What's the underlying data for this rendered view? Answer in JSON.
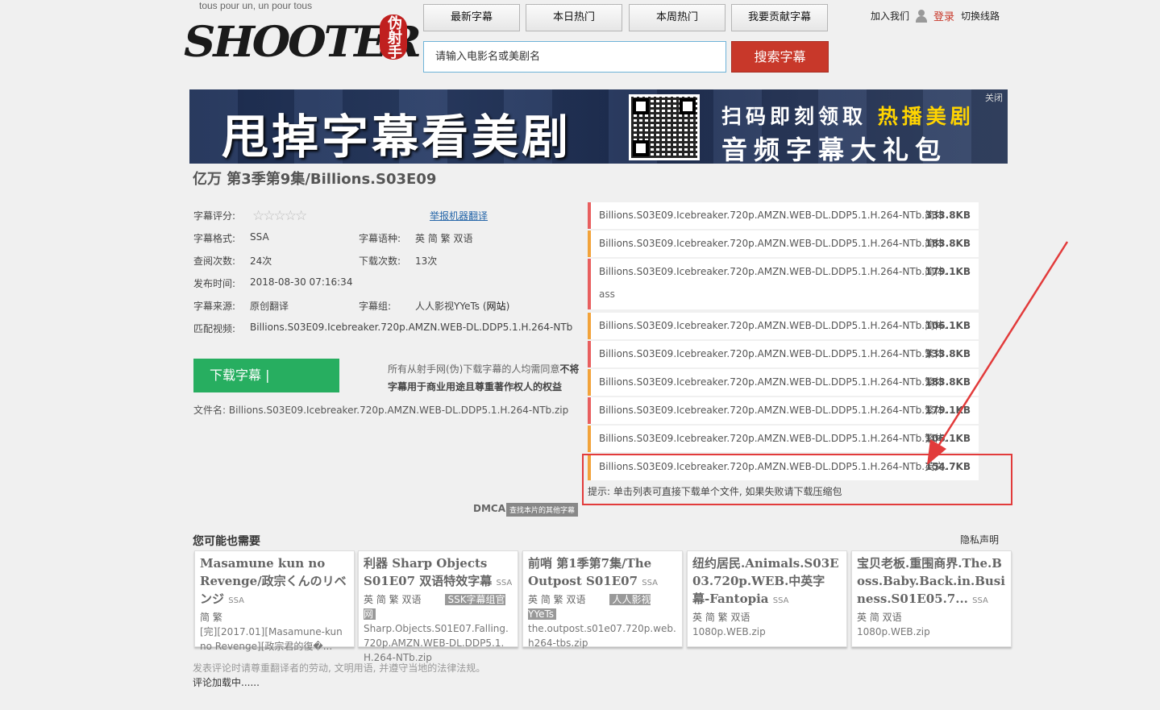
{
  "header": {
    "tagline": "tous pour un, un pour tous",
    "logo_text": "SHOOTER",
    "logo_seal": "伪射手",
    "nav": [
      "最新字幕",
      "本日热门",
      "本周热门",
      "我要贡献字幕"
    ],
    "search_placeholder": "请输入电影名或美剧名",
    "search_button": "搜索字幕",
    "join": "加入我们",
    "login": "登录",
    "switch_line": "切换线路"
  },
  "banner": {
    "title": "甩掉字幕看美剧",
    "line1_a": "扫码即刻领取",
    "line1_b": "热播美剧",
    "line2": "音频字幕大礼包",
    "close": "关闭"
  },
  "page_title": "亿万 第3季第9集/Billions.S03E09",
  "info": {
    "rating_label": "字幕评分:",
    "rating_stars": "☆☆☆☆☆",
    "report": "举报机器翻译",
    "format_label": "字幕格式:",
    "format": "SSA",
    "lang_label": "字幕语种:",
    "lang": "英 简 繁 双语",
    "views_label": "查阅次数:",
    "views": "24次",
    "downloads_label": "下载次数:",
    "downloads": "13次",
    "date_label": "发布时间:",
    "date": "2018-08-30 07:16:34",
    "source_label": "字幕来源:",
    "source": "原创翻译",
    "group_label": "字幕组:",
    "group": "人人影视YYeTs (",
    "group_site": "网站",
    "group_close": ")",
    "match_label": "匹配视频:",
    "match": "Billions.S03E09.Icebreaker.720p.AMZN.WEB-DL.DDP5.1.H.264-NTb"
  },
  "download": {
    "button": "下载字幕 |",
    "notice_a": "所有从射手网(伪)下载字幕的人均需同意",
    "notice_b": "不将字幕用于商业用途且尊重著作权人的权益",
    "filename_label": "文件名:",
    "filename": "Billions.S03E09.Icebreaker.720p.AMZN.WEB-DL.DDP5.1.H.264-NTb.zip"
  },
  "files": [
    {
      "name": "Billions.S03E09.Icebreaker.720p.AMZN.WEB-DL.DDP5.1.H.264-NTb.简体",
      "size": "333.8KB",
      "color": "red",
      "ext": ""
    },
    {
      "name": "Billions.S03E09.Icebreaker.720p.AMZN.WEB-DL.DDP5.1.H.264-NTb.简体",
      "size": "183.8KB",
      "color": "orange",
      "ext": ""
    },
    {
      "name": "Billions.S03E09.Icebreaker.720p.AMZN.WEB-DL.DDP5.1.H.264-NTb.简体.",
      "size": "179.1KB",
      "color": "red",
      "ext": "ass"
    },
    {
      "name": "Billions.S03E09.Icebreaker.720p.AMZN.WEB-DL.DDP5.1.H.264-NTb.简体.",
      "size": "106.1KB",
      "color": "orange",
      "ext": ""
    },
    {
      "name": "Billions.S03E09.Icebreaker.720p.AMZN.WEB-DL.DDP5.1.H.264-NTb.繁体",
      "size": "333.8KB",
      "color": "red",
      "ext": ""
    },
    {
      "name": "Billions.S03E09.Icebreaker.720p.AMZN.WEB-DL.DDP5.1.H.264-NTb.繁体",
      "size": "183.8KB",
      "color": "orange",
      "ext": ""
    },
    {
      "name": "Billions.S03E09.Icebreaker.720p.AMZN.WEB-DL.DDP5.1.H.264-NTb.繁体.",
      "size": "179.1KB",
      "color": "red",
      "ext": ""
    },
    {
      "name": "Billions.S03E09.Icebreaker.720p.AMZN.WEB-DL.DDP5.1.H.264-NTb.繁体.",
      "size": "106.1KB",
      "color": "orange",
      "ext": ""
    },
    {
      "name": "Billions.S03E09.Icebreaker.720p.AMZN.WEB-DL.DDP5.1.H.264-NTb.英文.",
      "size": "154.7KB",
      "color": "orange",
      "ext": ""
    }
  ],
  "hint": "提示: 单击列表可直接下载单个文件, 如果失败请下载压缩包",
  "dmca": "DMCA",
  "dmca_tag": "查找本片的其他字幕",
  "related": {
    "title": "您可能也需要",
    "privacy": "隐私声明",
    "cards": [
      {
        "title": "Masamune kun no Revenge/政宗くんのリベンジ",
        "fmt": "SSA",
        "lang": "简 繁",
        "tag": "",
        "file": "[完][2017.01][Masamune-kun no Revenge][政宗君的復�..."
      },
      {
        "title": "利器 Sharp Objects S01E07 双语特效字幕",
        "fmt": "SSA",
        "lang": "英 简 繁 双语",
        "tag": "SSK字幕组官网",
        "file": "Sharp.Objects.S01E07.Falling.720p.AMZN.WEB-DL.DDP5.1.H.264-NTb.zip"
      },
      {
        "title": "前哨 第1季第7集/The Outpost S01E07",
        "fmt": "SSA",
        "lang": "英 简 繁 双语",
        "tag": "人人影视YYeTs",
        "file": "the.outpost.s01e07.720p.web.h264-tbs.zip"
      },
      {
        "title": "纽约居民.Animals.S03E03.720p.WEB.中英字幕-Fantopia",
        "fmt": "SSA",
        "lang": "英 简 繁 双语",
        "tag": "",
        "file": "1080p.WEB.zip"
      },
      {
        "title": "宝贝老板.重围商界.The.Boss.Baby.Back.in.Business.S01E05.7...",
        "fmt": "SSA",
        "lang": "英 简 双语",
        "tag": "",
        "file": "1080p.WEB.zip"
      }
    ]
  },
  "footer": {
    "rule": "发表评论时请尊重翻译者的劳动, 文明用语, 并遵守当地的法律法规。",
    "loading": "评论加载中......"
  }
}
